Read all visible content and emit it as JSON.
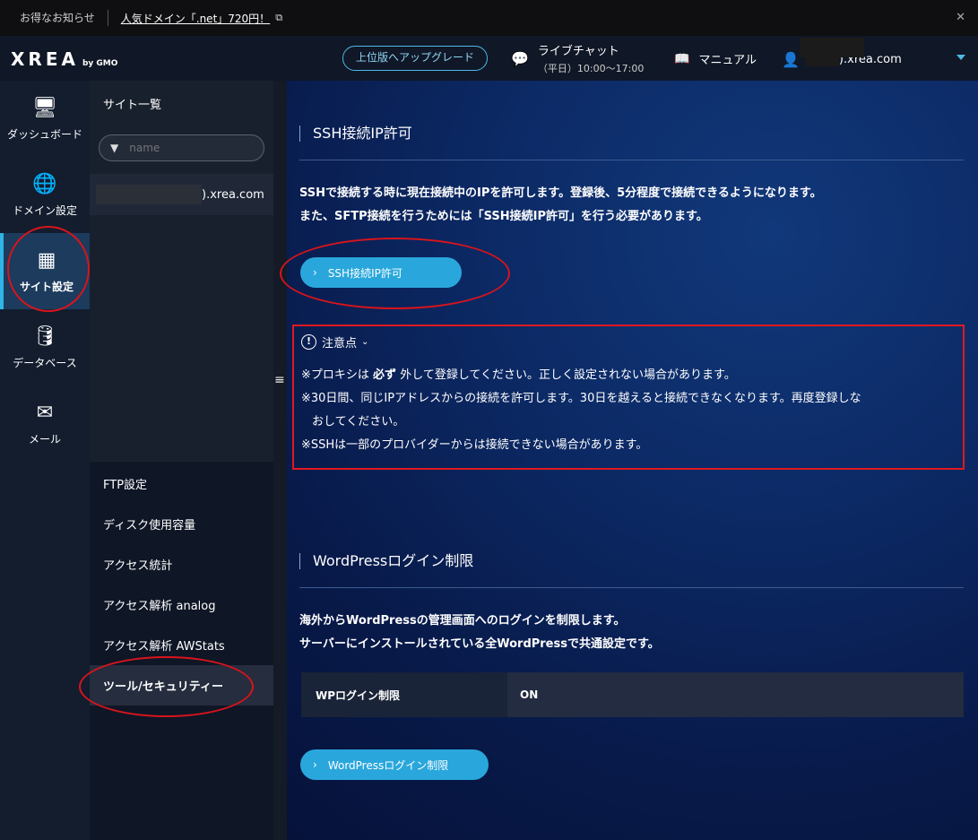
{
  "notice": {
    "label": "お得なお知らせ",
    "link": "人気ドメイン「.net」720円！",
    "external_icon": "external-link-icon",
    "close_icon": "close-icon"
  },
  "header": {
    "logo": "XREA",
    "logo_sub": "by GMO",
    "upgrade": "上位版へアップグレード",
    "chat_title": "ライブチャット",
    "chat_hours": "（平日）10:00〜17:00",
    "manual": "マニュアル",
    "user_domain": ").xrea.com"
  },
  "leftnav": [
    {
      "label": "ダッシュボード",
      "icon": "monitor-icon"
    },
    {
      "label": "ドメイン設定",
      "icon": "globe-icon"
    },
    {
      "label": "サイト設定",
      "icon": "site-settings-icon"
    },
    {
      "label": "データベース",
      "icon": "database-icon"
    },
    {
      "label": "メール",
      "icon": "mail-icon"
    }
  ],
  "subnav": {
    "title": "サイト一覧",
    "search_placeholder": "name",
    "site": ").xrea.com"
  },
  "settings": [
    "FTP設定",
    "ディスク使用容量",
    "アクセス統計",
    "アクセス解析 analog",
    "アクセス解析 AWStats",
    "ツール/セキュリティー"
  ],
  "ssh": {
    "heading": "SSH接続IP許可",
    "line1": "SSHで接続する時に現在接続中のIPを許可します。登録後、5分程度で接続できるようになります。",
    "line2": "また、SFTP接続を行うためには「SSH接続IP許可」を行う必要があります。",
    "button": "SSH接続IP許可"
  },
  "caution": {
    "title": "注意点",
    "l1a": "※プロキシは",
    "l1b": "必ず",
    "l1c": "外して登録してください。正しく設定されない場合があります。",
    "l2": "※30日間、同じIPアドレスからの接続を許可します。30日を越えると接続できなくなります。再度登録しな",
    "l2b": "おしてください。",
    "l3": "※SSHは一部のプロバイダーからは接続できない場合があります。"
  },
  "wordpress": {
    "heading": "WordPressログイン制限",
    "line1": "海外からWordPressの管理画面へのログインを制限します。",
    "line2": "サーバーにインストールされている全WordPressで共通設定です。",
    "table_key": "WPログイン制限",
    "table_value": "ON",
    "button": "WordPressログイン制限"
  }
}
